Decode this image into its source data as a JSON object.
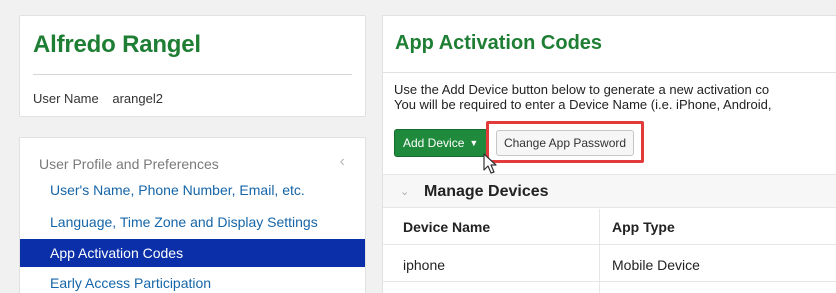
{
  "profile": {
    "full_name": "Alfredo Rangel",
    "user_name_label": "User Name",
    "user_name_value": "arangel2"
  },
  "sidebar": {
    "heading": "User Profile and Preferences",
    "collapse_icon": "chevron-left-icon",
    "items": [
      {
        "label": "User's Name, Phone Number, Email, etc.",
        "active": false
      },
      {
        "label": "Language, Time Zone and Display Settings",
        "active": false
      },
      {
        "label": "App Activation Codes",
        "active": true
      },
      {
        "label": "Early Access Participation",
        "active": false
      }
    ]
  },
  "main": {
    "title": "App Activation Codes",
    "description_line1": "Use the Add Device button below to generate a new activation co",
    "description_line2": "You will be required to enter a Device Name (i.e. iPhone, Android,",
    "add_device_label": "Add Device",
    "change_password_label": "Change App Password",
    "section_title": "Manage Devices",
    "table": {
      "headers": [
        "Device Name",
        "App Type"
      ],
      "rows": [
        [
          "iphone",
          "Mobile Device"
        ]
      ]
    }
  },
  "colors": {
    "title_green": "#1e7e34",
    "button_green": "#1f8a3c",
    "active_nav": "#0a2fa8",
    "link_blue": "#1565a8",
    "highlight_red": "#e23b3b"
  }
}
